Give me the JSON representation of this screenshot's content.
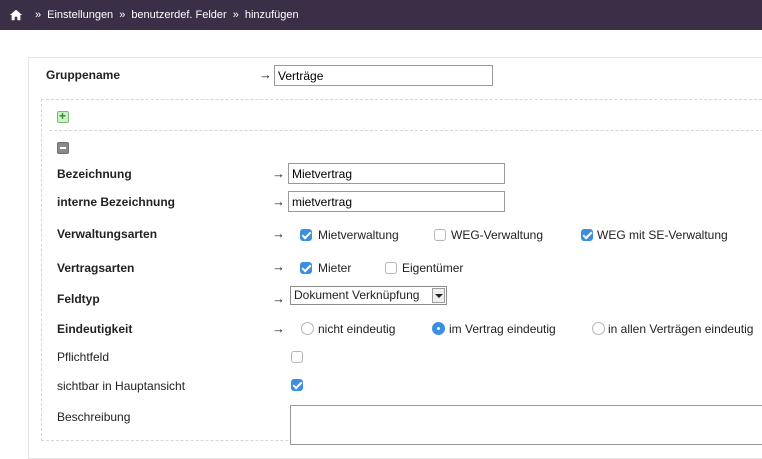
{
  "breadcrumb": {
    "items": [
      "Einstellungen",
      "benutzerdef. Felder",
      "hinzufügen"
    ],
    "separator": "»"
  },
  "arrow_glyph": "→",
  "group": {
    "label": "Gruppename",
    "value": "Verträge"
  },
  "fields": {
    "bezeichnung": {
      "label": "Bezeichnung",
      "value": "Mietvertrag"
    },
    "interne_bezeichnung": {
      "label": "interne Bezeichnung",
      "value": "mietvertrag"
    },
    "verwaltungsarten": {
      "label": "Verwaltungsarten",
      "options": [
        {
          "label": "Mietverwaltung",
          "checked": true
        },
        {
          "label": "WEG-Verwaltung",
          "checked": false
        },
        {
          "label": "WEG mit SE-Verwaltung",
          "checked": true
        }
      ]
    },
    "vertragsarten": {
      "label": "Vertragsarten",
      "options": [
        {
          "label": "Mieter",
          "checked": true
        },
        {
          "label": "Eigentümer",
          "checked": false
        }
      ]
    },
    "feldtyp": {
      "label": "Feldtyp",
      "selected": "Dokument Verknüpfung"
    },
    "eindeutigkeit": {
      "label": "Eindeutigkeit",
      "options": [
        {
          "label": "nicht eindeutig",
          "selected": false
        },
        {
          "label": "im Vertrag eindeutig",
          "selected": true
        },
        {
          "label": "in allen Verträgen eindeutig",
          "selected": false
        }
      ]
    },
    "pflichtfeld": {
      "label": "Pflichtfeld",
      "checked": false
    },
    "sichtbar": {
      "label": "sichtbar in Hauptansicht",
      "checked": true
    },
    "beschreibung": {
      "label": "Beschreibung",
      "value": ""
    }
  },
  "colors": {
    "topbar": "#3b2f47",
    "accent": "#3c8fe0"
  },
  "icons": {
    "home": "home-icon",
    "add": "plus-icon",
    "remove": "minus-icon"
  }
}
